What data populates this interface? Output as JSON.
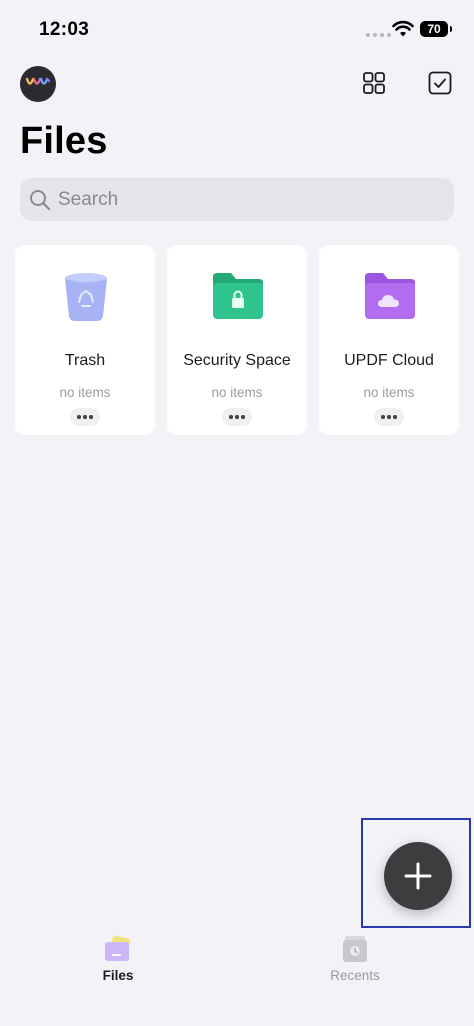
{
  "status_bar": {
    "time": "12:03",
    "battery": "70"
  },
  "header": {
    "title": "Files"
  },
  "search": {
    "placeholder": "Search"
  },
  "folders": [
    {
      "name": "Trash",
      "subtitle": "no items",
      "icon": "trash-icon",
      "color": "#a7b3f5"
    },
    {
      "name": "Security Space",
      "subtitle": "no items",
      "icon": "lock-folder-icon",
      "color": "#2fc48d"
    },
    {
      "name": "UPDF Cloud",
      "subtitle": "no items",
      "icon": "cloud-folder-icon",
      "color": "#b26cf0"
    }
  ],
  "fab": {
    "icon": "plus-icon",
    "color": "#3d3d40"
  },
  "tabs": [
    {
      "label": "Files",
      "icon": "files-tab-icon",
      "active": true
    },
    {
      "label": "Recents",
      "icon": "recents-tab-icon",
      "active": false
    }
  ],
  "colors": {
    "background": "#f2f2f7",
    "card": "#ffffff",
    "highlight": "#2b3aa8"
  }
}
